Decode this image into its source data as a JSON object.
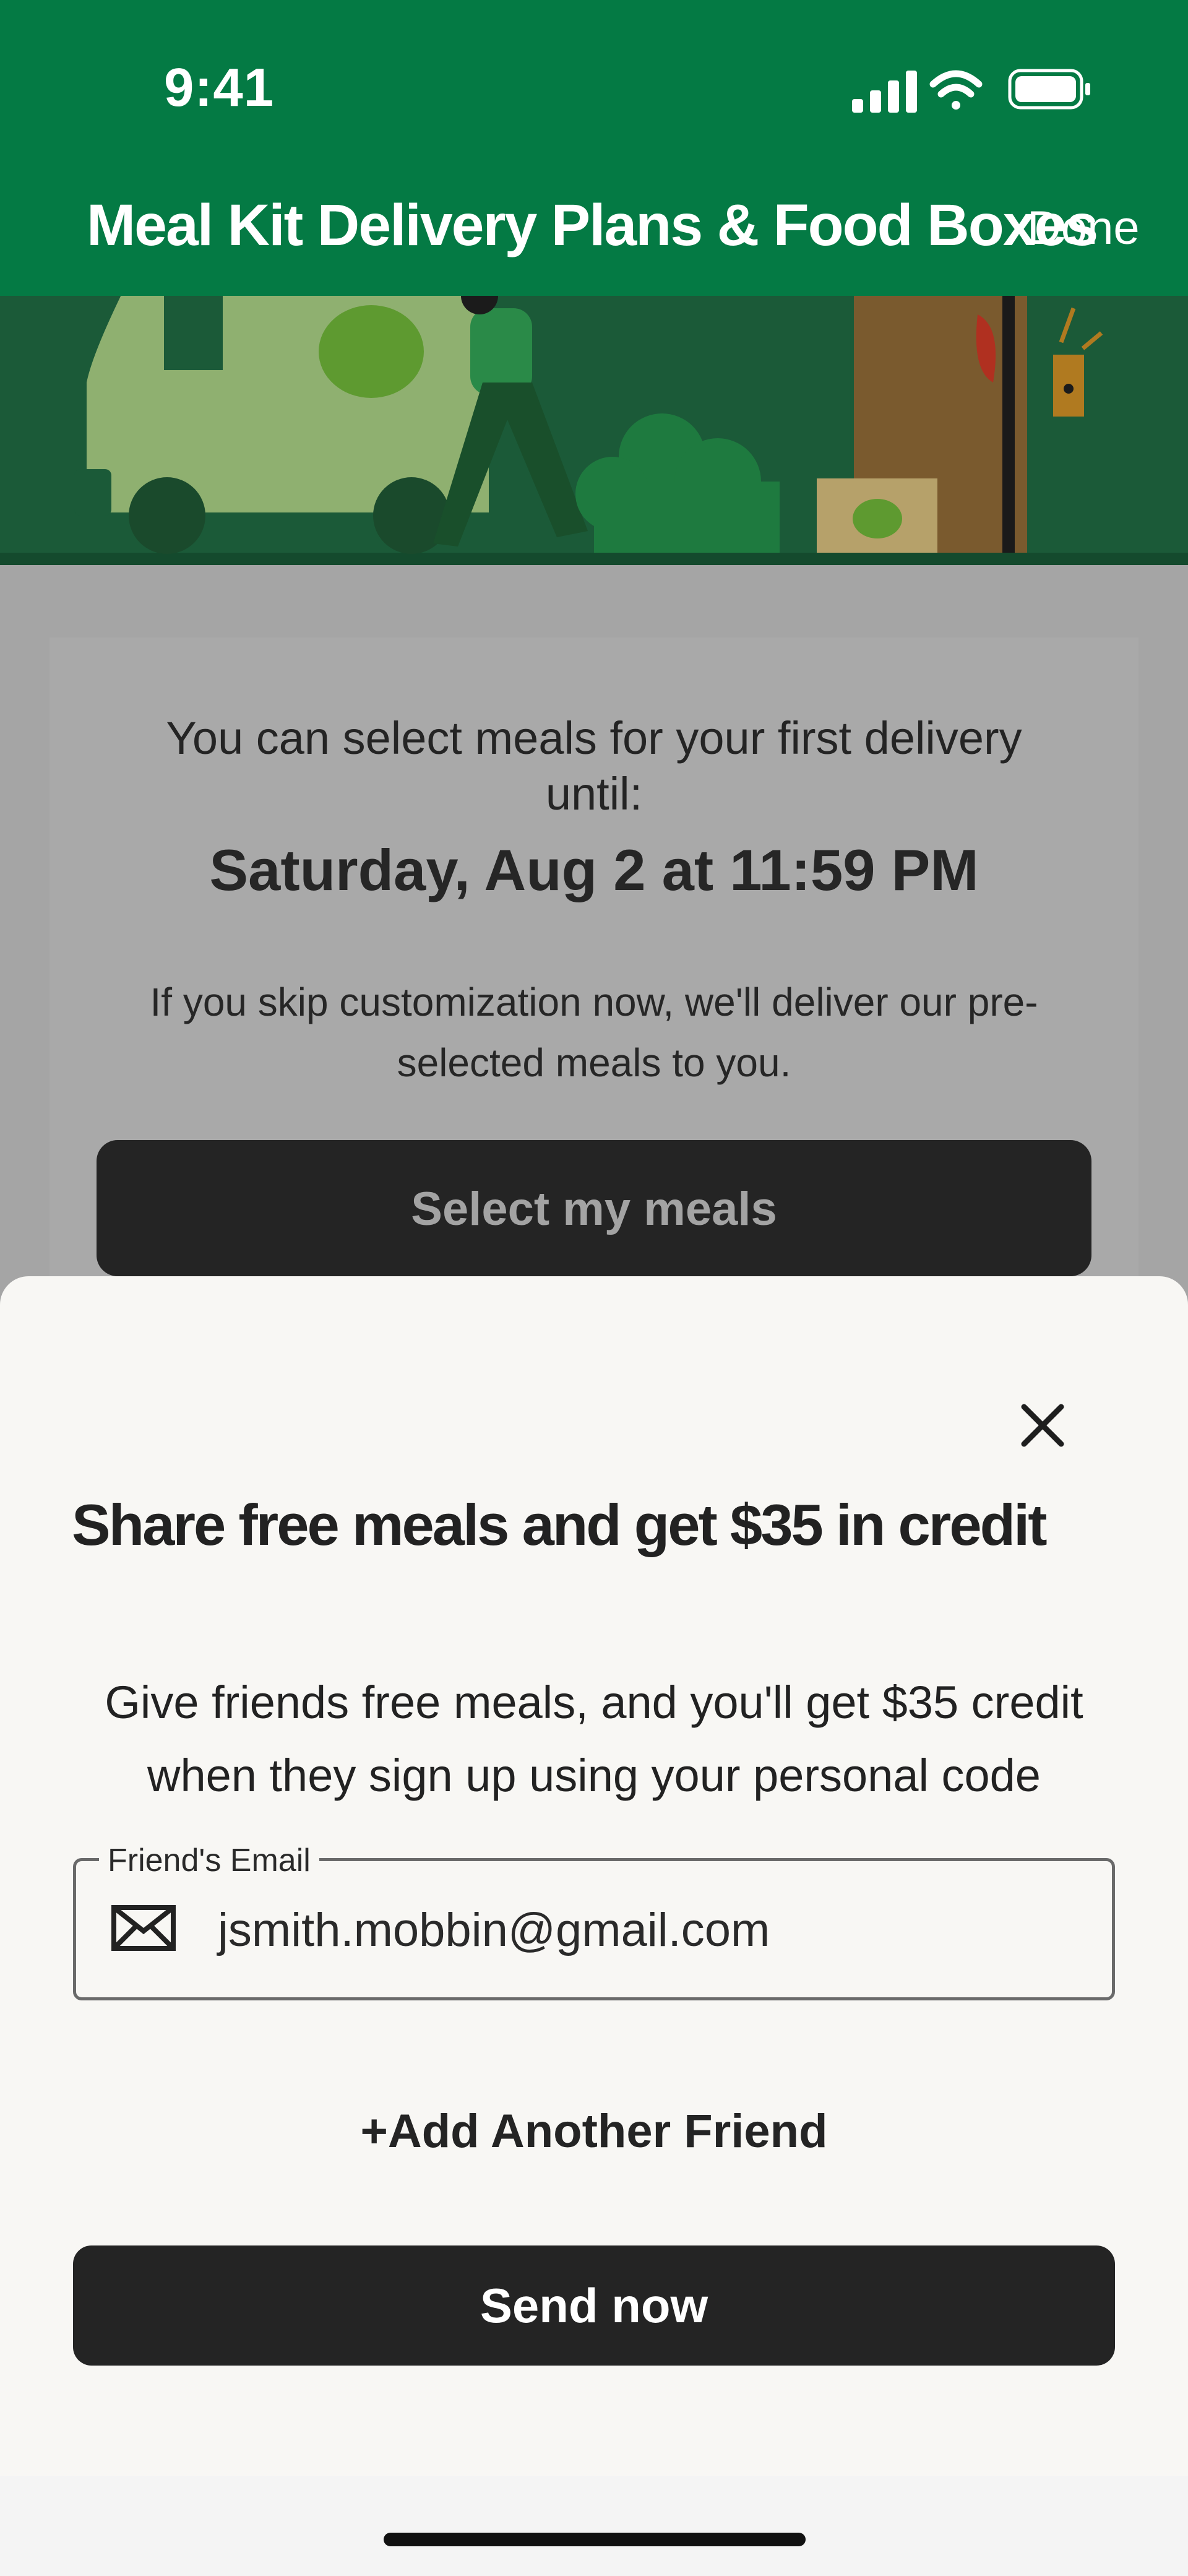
{
  "status_bar": {
    "time": "9:41"
  },
  "header": {
    "title": "Meal Kit Delivery Plans & Food Boxes",
    "done_label": "Done"
  },
  "delivery_info": {
    "intro": "You can select meals for your first delivery until:",
    "cutoff": "Saturday, Aug 2 at 11:59 PM",
    "skip_note": "If you skip customization now, we'll deliver our pre-selected meals to you.",
    "select_button": "Select my meals"
  },
  "referral_sheet": {
    "title": "Share free meals and get $35 in credit",
    "description": "Give friends free meals, and you'll get $35 credit when they sign up using your personal code",
    "email_label": "Friend's Email",
    "email_value": "jsmith.mobbin@gmail.com",
    "add_friend_label": "+Add Another Friend",
    "send_label": "Send now"
  },
  "colors": {
    "brand_green": "#047a44",
    "dark_button": "#242424",
    "sheet_background": "#f8f7f4"
  },
  "icons": [
    "signal-icon",
    "wifi-icon",
    "battery-icon",
    "close-icon",
    "mail-icon"
  ]
}
